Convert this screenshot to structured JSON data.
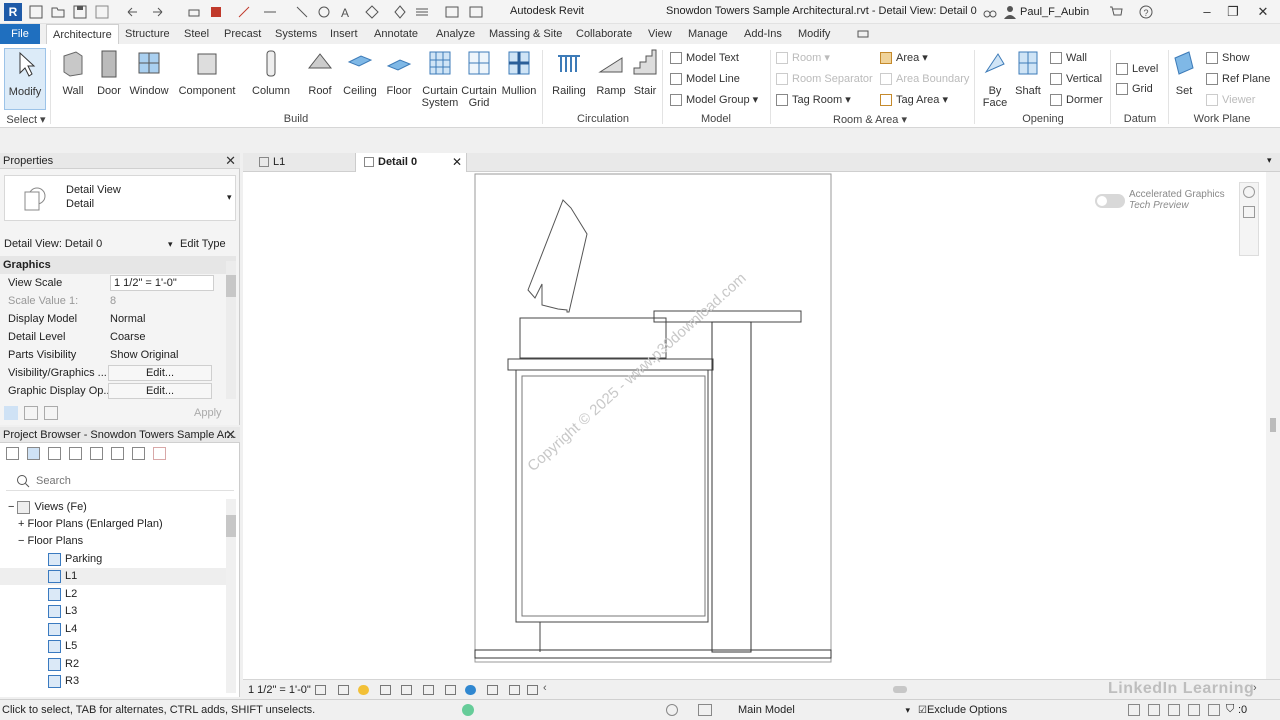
{
  "title": {
    "app": "Autodesk Revit",
    "file": "Snowdon Towers Sample Architectural.rvt - Detail View: Detail 0",
    "user": "Paul_F_Aubin"
  },
  "tabs": [
    "File",
    "Architecture",
    "Structure",
    "Steel",
    "Precast",
    "Systems",
    "Insert",
    "Annotate",
    "Analyze",
    "Massing & Site",
    "Collaborate",
    "View",
    "Manage",
    "Add-Ins",
    "Modify"
  ],
  "ribbon": {
    "modify": "Modify",
    "build": [
      "Wall",
      "Door",
      "Window",
      "Component",
      "Column",
      "Roof",
      "Ceiling",
      "Floor",
      "Curtain System",
      "Curtain Grid",
      "Mullion"
    ],
    "circulation": [
      "Railing",
      "Ramp",
      "Stair"
    ],
    "model": [
      "Model Text",
      "Model Line",
      "Model Group"
    ],
    "room_area": [
      "Room",
      "Room Separator",
      "Tag Room",
      "Area",
      "Area Boundary",
      "Tag Area"
    ],
    "opening": [
      "By Face",
      "Shaft",
      "Wall",
      "Vertical",
      "Dormer"
    ],
    "datum": [
      "Level",
      "Grid"
    ],
    "workplane": [
      "Set",
      "Show",
      "Ref Plane",
      "Viewer"
    ],
    "groups": {
      "select": "Select",
      "build": "Build",
      "circulation": "Circulation",
      "model": "Model",
      "room_area": "Room & Area",
      "opening": "Opening",
      "datum": "Datum",
      "workplane": "Work Plane"
    }
  },
  "properties": {
    "title": "Properties",
    "type_line1": "Detail View",
    "type_line2": "Detail",
    "instance": "Detail View: Detail 0",
    "edit_type": "Edit Type",
    "section": "Graphics",
    "rows": [
      {
        "k": "View Scale",
        "v": "1 1/2\" = 1'-0\""
      },
      {
        "k": "Scale Value   1:",
        "v": "8"
      },
      {
        "k": "Display Model",
        "v": "Normal"
      },
      {
        "k": "Detail Level",
        "v": "Coarse"
      },
      {
        "k": "Parts Visibility",
        "v": "Show Original"
      },
      {
        "k": "Visibility/Graphics ...",
        "v": "Edit..."
      },
      {
        "k": "Graphic Display Op...",
        "v": "Edit..."
      }
    ],
    "apply": "Apply"
  },
  "browser": {
    "title": "Project Browser - Snowdon Towers Sample Ar...",
    "search_placeholder": "Search",
    "items": [
      "Views (Fe)",
      "Floor Plans (Enlarged Plan)",
      "Floor Plans",
      "Parking",
      "L1",
      "L2",
      "L3",
      "L4",
      "L5",
      "R2",
      "R3"
    ]
  },
  "view_tabs": [
    "L1",
    "Detail 0"
  ],
  "canvas": {
    "accel_title": "Accelerated Graphics",
    "accel_sub": "Tech Preview",
    "watermark": "Copyright © 2025 - www.p30download.com"
  },
  "view_control": {
    "scale": "1 1/2\" = 1'-0\""
  },
  "status": {
    "hint": "Click to select, TAB for alternates, CTRL adds, SHIFT unselects.",
    "model": "Main Model",
    "exclude": "Exclude Options",
    "filter": ":0"
  },
  "brand": "LinkedIn Learning",
  "colors": {
    "accent": "#1f6fbf",
    "file_tab": "#1f6fbf"
  }
}
